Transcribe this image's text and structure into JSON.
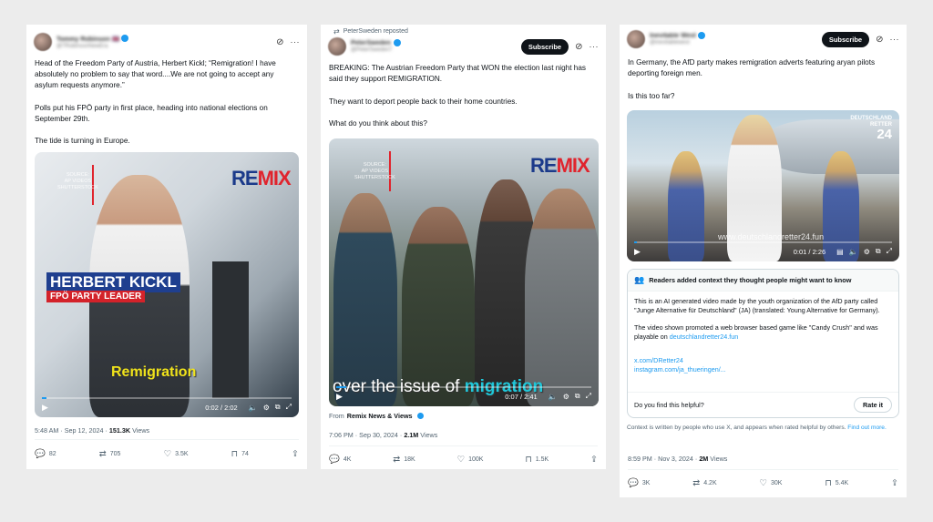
{
  "tweets": [
    {
      "display_name": "Tommy Robinson 🇬🇧",
      "handle": "@TRobinsonNewEra",
      "more": "···",
      "text": [
        "Head of the Freedom Party of Austria, Herbert Kickl; “Remigration! I have absolutely no problem to say that word....We are not going to accept any asylum requests anymore.”",
        "Polls put his FPÖ party in first place, heading into national elections on September 29th.",
        "The tide is turning in Europe."
      ],
      "video": {
        "source_label": "SOURCE:\nAP VIDEOS\nSHUTTERSTOCK",
        "logo_re": "RE",
        "logo_mix": "MIX",
        "lower_third_name": "HERBERT KICKL",
        "lower_third_role": "FPÖ PARTY LEADER",
        "caption": "Remigration",
        "time": "0:02 / 2:02",
        "progress": 0.02
      },
      "timestamp": "5:48 AM · Sep 12, 2024 · ",
      "views_count": "151.3K",
      "views_label": " Views",
      "replies": "82",
      "reposts": "705",
      "likes": "3.5K",
      "bookmarks": "74"
    },
    {
      "reposted_by": "PeterSweden reposted",
      "display_name": "PeterSweden",
      "handle": "@PeterSweden7",
      "subscribe": "Subscribe",
      "more": "···",
      "text": [
        "BREAKING: The Austrian Freedom Party that WON the election last night has said they support REMIGRATION.",
        "They want to deport people back to their home countries.",
        "What do you think about this?"
      ],
      "video": {
        "source_label": "SOURCE:\nAP VIDEOS\nSHUTTERSTOCK",
        "logo_re": "RE",
        "logo_mix": "MIX",
        "caption_pre": "over the issue of ",
        "caption_hl": "migration",
        "time": "0:07 / 2:41",
        "progress": 0.04
      },
      "from_label": "From ",
      "from_source": "Remix News & Views",
      "timestamp": "7:06 PM · Sep 30, 2024 · ",
      "views_count": "2.1M",
      "views_label": " Views",
      "replies": "4K",
      "reposts": "18K",
      "likes": "100K",
      "bookmarks": "1.5K"
    },
    {
      "display_name": "Inevitable West",
      "handle": "@inevitablewest",
      "subscribe": "Subscribe",
      "more": "···",
      "text": [
        "In Germany, the AfD party makes remigration adverts featuring aryan pilots deporting foreign men.",
        "Is this too far?"
      ],
      "video": {
        "watermark_top": "DEUTSCHLAND\nRETTER",
        "watermark_num": "24",
        "url_overlay": "www.deutschlandretter24.fun",
        "time": "0:01 / 2:26",
        "progress": 0.01
      },
      "community_note": {
        "header": "Readers added context they thought people might want to know",
        "body_1": "This is an AI generated video made by the youth organization of the AfD party called \"Junge Alternative für Deutschland\" (JA) (translated: Young Alternative for Germany).",
        "body_2_pre": "The video shown promoted a web browser based game like \"Candy Crush\" and was playable on ",
        "body_2_link": "deutschlandretter24.fun",
        "link_1": "x.com/DRetter24",
        "link_2": "instagram.com/ja_thueringen/...",
        "helpful_q": "Do you find this helpful?",
        "rate_it": "Rate it",
        "disclaimer_pre": "Context is written by people who use X, and appears when rated helpful by others. ",
        "disclaimer_link": "Find out more."
      },
      "timestamp": "8:59 PM · Nov 3, 2024 · ",
      "views_count": "2M",
      "views_label": " Views",
      "replies": "3K",
      "reposts": "4.2K",
      "likes": "30K",
      "bookmarks": "5.4K"
    }
  ]
}
